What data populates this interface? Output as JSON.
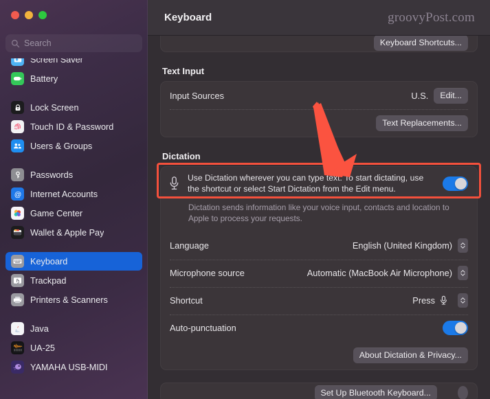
{
  "window": {
    "traffic_lights": [
      {
        "name": "close",
        "color": "#f05b4f"
      },
      {
        "name": "minimize",
        "color": "#f2b33d"
      },
      {
        "name": "zoom",
        "color": "#2dc93f"
      }
    ]
  },
  "sidebar": {
    "search": {
      "placeholder": "Search",
      "value": ""
    },
    "groups": [
      {
        "items": [
          {
            "label": "Screen Saver",
            "icon": "screen-saver-icon",
            "color": "#4eb3f5",
            "selected": false
          },
          {
            "label": "Battery",
            "icon": "battery-icon",
            "color": "#34c759",
            "selected": false
          }
        ]
      },
      {
        "items": [
          {
            "label": "Lock Screen",
            "icon": "lock-screen-icon",
            "color": "#1c1c1e",
            "selected": false
          },
          {
            "label": "Touch ID & Password",
            "icon": "touch-id-icon",
            "color": "#f2f2f4",
            "selected": false
          },
          {
            "label": "Users & Groups",
            "icon": "users-groups-icon",
            "color": "#1f8ef1",
            "selected": false
          }
        ]
      },
      {
        "items": [
          {
            "label": "Passwords",
            "icon": "passwords-icon",
            "color": "#8e8e93",
            "selected": false
          },
          {
            "label": "Internet Accounts",
            "icon": "internet-accounts-icon",
            "color": "#1f78e8",
            "selected": false
          },
          {
            "label": "Game Center",
            "icon": "game-center-icon",
            "color": "#f7f5fa",
            "selected": false
          },
          {
            "label": "Wallet & Apple Pay",
            "icon": "wallet-apple-pay-icon",
            "color": "#1c1c1e",
            "selected": false
          }
        ]
      },
      {
        "items": [
          {
            "label": "Keyboard",
            "icon": "keyboard-icon",
            "color": "#9a9aa0",
            "selected": true
          },
          {
            "label": "Trackpad",
            "icon": "trackpad-icon",
            "color": "#9a9aa0",
            "selected": false
          },
          {
            "label": "Printers & Scanners",
            "icon": "printers-scanners-icon",
            "color": "#9a9aa0",
            "selected": false
          }
        ]
      },
      {
        "items": [
          {
            "label": "Java",
            "icon": "java-icon",
            "color": "#f4f4f6",
            "selected": false
          },
          {
            "label": "UA-25",
            "icon": "ua-25-icon",
            "color": "#141416",
            "selected": false
          },
          {
            "label": "YAMAHA USB-MIDI",
            "icon": "yamaha-usb-midi-icon",
            "color": "#3a2a66",
            "selected": false
          }
        ]
      }
    ]
  },
  "header": {
    "title": "Keyboard",
    "watermark": "groovyPost.com"
  },
  "main": {
    "shortcuts_card": {
      "button_label": "Keyboard Shortcuts..."
    },
    "text_input": {
      "section_title": "Text Input",
      "input_sources_label": "Input Sources",
      "input_sources_value": "U.S.",
      "edit_button": "Edit...",
      "text_replacements_button": "Text Replacements..."
    },
    "dictation": {
      "section_title": "Dictation",
      "description": "Use Dictation wherever you can type text. To start dictating, use the shortcut or select Start Dictation from the Edit menu.",
      "enabled": true,
      "privacy_note": "Dictation sends information like your voice input, contacts and location to Apple to process your requests.",
      "rows": [
        {
          "label": "Language",
          "value": "English (United Kingdom)",
          "control": "stepper"
        },
        {
          "label": "Microphone source",
          "value": "Automatic (MacBook Air Microphone)",
          "control": "stepper"
        },
        {
          "label": "Shortcut",
          "value": "Press",
          "control": "stepper-mic"
        },
        {
          "label": "Auto-punctuation",
          "value": "",
          "control": "toggle-on"
        }
      ],
      "about_button": "About Dictation & Privacy..."
    },
    "bottom": {
      "button_label": "Set Up Bluetooth Keyboard..."
    }
  },
  "annotation": {
    "arrow_color": "#fb5340",
    "highlight_color": "#f4503c"
  }
}
